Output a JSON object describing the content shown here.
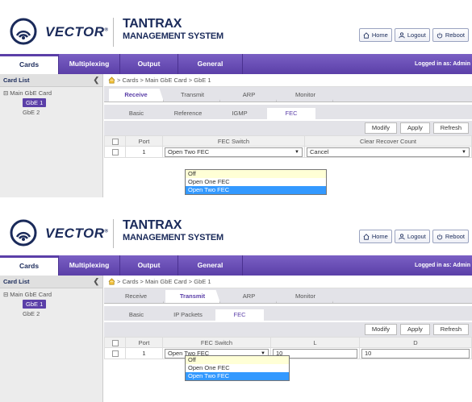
{
  "brand": {
    "name": "VECTOR",
    "reg": "®",
    "title_line1": "TANTRAX",
    "title_line2": "MANAGEMENT SYSTEM"
  },
  "header_buttons": {
    "home": "Home",
    "logout": "Logout",
    "reboot": "Reboot"
  },
  "nav": {
    "items": [
      "Cards",
      "Multiplexing",
      "Output",
      "General"
    ],
    "active": "Cards",
    "user": "Logged in as: Admin"
  },
  "sidebar": {
    "title": "Card List",
    "root": "Main GbE Card",
    "children": [
      "GbE 1",
      "GbE 2"
    ],
    "selected": "GbE 1"
  },
  "breadcrumb": "> Cards > Main GbE Card > GbE 1",
  "actions": {
    "modify": "Modify",
    "apply": "Apply",
    "refresh": "Refresh"
  },
  "panel1": {
    "tabs": [
      "Receive",
      "Transmit",
      "ARP",
      "Monitor"
    ],
    "active_tab": "Receive",
    "subtabs": [
      "Basic",
      "Reference",
      "IGMP",
      "FEC"
    ],
    "active_subtab": "FEC",
    "columns": {
      "port": "Port",
      "fec_switch": "FEC Switch",
      "clear_recover": "Clear Recover Count"
    },
    "row": {
      "port": "1",
      "fec_switch": "Open Two FEC",
      "clear_recover": "Cancel"
    },
    "dropdown_options": [
      "Off",
      "Open One FEC",
      "Open Two FEC"
    ],
    "dropdown_highlight": "Open Two FEC"
  },
  "panel2": {
    "tabs": [
      "Receive",
      "Transmit",
      "ARP",
      "Monitor"
    ],
    "active_tab": "Transmit",
    "subtabs": [
      "Basic",
      "IP Packets",
      "FEC"
    ],
    "active_subtab": "FEC",
    "columns": {
      "port": "Port",
      "fec_switch": "FEC Switch",
      "l": "L",
      "d": "D"
    },
    "row": {
      "port": "1",
      "fec_switch": "Open Two FEC",
      "l": "10",
      "d": "10"
    },
    "dropdown_options": [
      "Off",
      "Open One FEC",
      "Open Two FEC"
    ],
    "dropdown_highlight": "Open Two FEC"
  },
  "colors": {
    "nav": "#5b3fa8",
    "brand": "#1a2a5a",
    "selection": "#3399ff"
  }
}
